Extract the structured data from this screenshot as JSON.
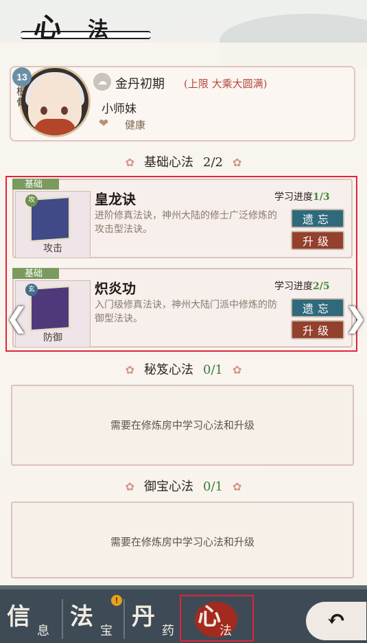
{
  "header": {
    "title_main": "心",
    "title_second": "法"
  },
  "profile": {
    "root_value": "13",
    "root_label": "根骨",
    "realm": "金丹初期",
    "realm_limit": "(上限 大乘大圆满)",
    "name": "小师妹",
    "status": "健康"
  },
  "sections": {
    "basic": {
      "title": "基础心法",
      "count": "2/2"
    },
    "secret": {
      "title": "秘笈心法",
      "count": "0/1"
    },
    "treasure": {
      "title": "御宝心法",
      "count": "0/1"
    }
  },
  "skills": [
    {
      "tag": "基础",
      "type_badge": "攻",
      "type": "攻击",
      "name": "皇龙诀",
      "desc": "进阶修真法诀，神州大陆的修士广泛修炼的攻击型法诀。",
      "progress_label": "学习进度",
      "progress_value": "1/3",
      "forget_label": "遗忘",
      "upgrade_label": "升级"
    },
    {
      "tag": "基础",
      "type_badge": "玄",
      "type": "防御",
      "name": "炽炎功",
      "desc": "入门级修真法诀，神州大陆门派中修炼的防御型法诀。",
      "progress_label": "学习进度",
      "progress_value": "2/5",
      "forget_label": "遗忘",
      "upgrade_label": "升级"
    }
  ],
  "empty_hint": "需要在修炼房中学习心法和升级",
  "tabs": [
    {
      "main": "信",
      "sub": "息"
    },
    {
      "main": "法",
      "sub": "宝"
    },
    {
      "main": "丹",
      "sub": "药"
    },
    {
      "main": "心",
      "sub": "法"
    }
  ],
  "alert_mark": "!",
  "icons": {
    "flower": "✿",
    "heart": "❤",
    "realm": "☁",
    "back": "↶",
    "prev": "❮",
    "next": "❯"
  },
  "colors": {
    "highlight": "#e0243a",
    "progress": "#3e8c33",
    "forget": "#2f6a7c",
    "upgrade": "#93402c",
    "tab_bar": "#3e4b56"
  }
}
